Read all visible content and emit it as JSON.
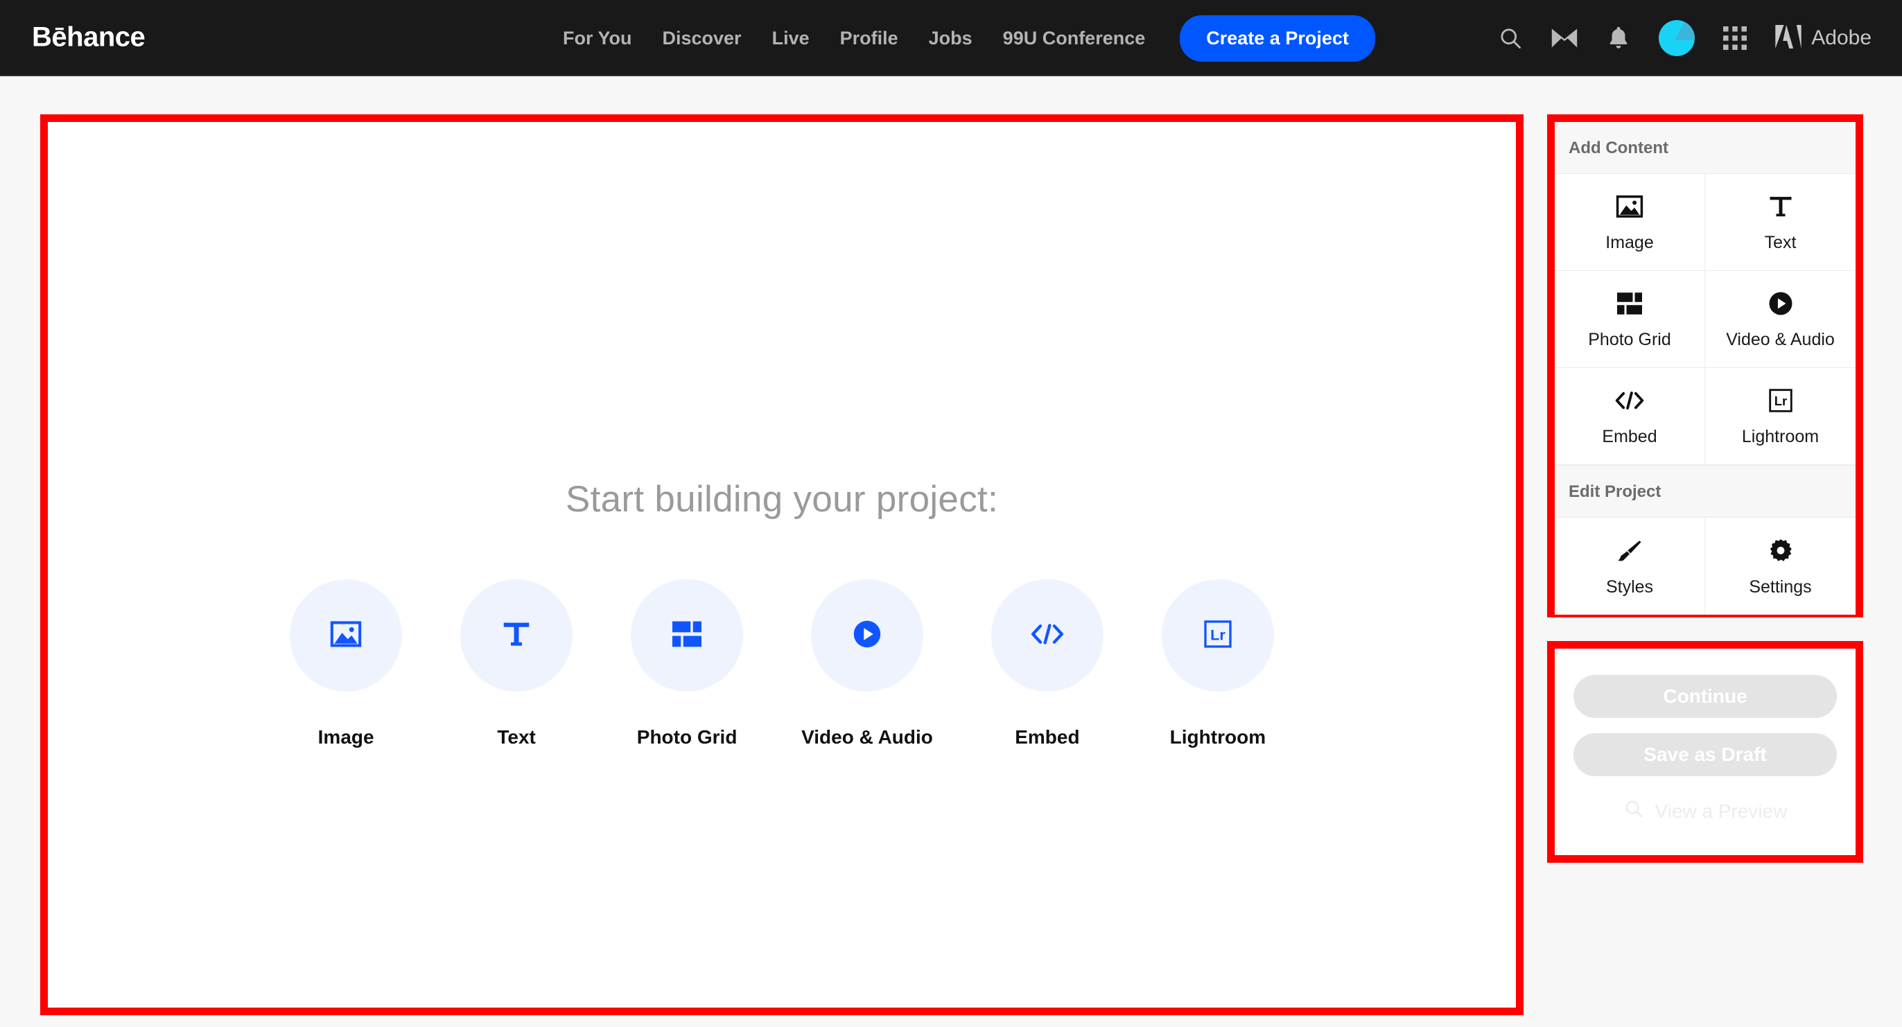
{
  "header": {
    "logo": "Bēhance",
    "nav": [
      {
        "label": "For You"
      },
      {
        "label": "Discover"
      },
      {
        "label": "Live"
      },
      {
        "label": "Profile"
      },
      {
        "label": "Jobs"
      },
      {
        "label": "99U Conference"
      }
    ],
    "create_button": "Create a Project",
    "icons": [
      {
        "name": "search-icon"
      },
      {
        "name": "mail-icon"
      },
      {
        "name": "bell-icon"
      }
    ],
    "avatar_label": "",
    "adobe_label": "Adobe",
    "colors": {
      "background": "#191919",
      "accent": "#0057ff",
      "nav_text": "#b3b3b3",
      "avatar": "#19d2f5"
    }
  },
  "canvas": {
    "title": "Start building your project:",
    "options": [
      {
        "label": "Image",
        "icon": "image-icon"
      },
      {
        "label": "Text",
        "icon": "text-icon"
      },
      {
        "label": "Photo Grid",
        "icon": "photo-grid-icon"
      },
      {
        "label": "Video & Audio",
        "icon": "video-audio-icon"
      },
      {
        "label": "Embed",
        "icon": "embed-icon"
      },
      {
        "label": "Lightroom",
        "icon": "lightroom-icon"
      }
    ],
    "colors": {
      "background": "#ffffff",
      "title_text": "#9a9a9a",
      "circle_bg": "#eef3fe",
      "icon": "#1155ff"
    }
  },
  "sidebar": {
    "add_content": {
      "heading": "Add Content",
      "items": [
        {
          "label": "Image",
          "icon": "image-icon"
        },
        {
          "label": "Text",
          "icon": "text-icon"
        },
        {
          "label": "Photo Grid",
          "icon": "photo-grid-icon"
        },
        {
          "label": "Video & Audio",
          "icon": "video-audio-icon"
        },
        {
          "label": "Embed",
          "icon": "embed-icon"
        },
        {
          "label": "Lightroom",
          "icon": "lightroom-icon"
        }
      ]
    },
    "edit_project": {
      "heading": "Edit Project",
      "items": [
        {
          "label": "Styles",
          "icon": "brush-icon"
        },
        {
          "label": "Settings",
          "icon": "gear-icon"
        }
      ]
    }
  },
  "actions": {
    "continue_label": "Continue",
    "save_draft_label": "Save as Draft",
    "preview_label": "View a Preview",
    "preview_icon": "search-icon",
    "disabled": true,
    "colors": {
      "button_bg": "#e4e4e4",
      "button_text": "#ffffff"
    }
  },
  "highlights": {
    "color": "#ff0000",
    "boxes": [
      {
        "name": "canvas-highlight"
      },
      {
        "name": "add-content-panel-highlight"
      },
      {
        "name": "actions-panel-highlight"
      }
    ]
  }
}
